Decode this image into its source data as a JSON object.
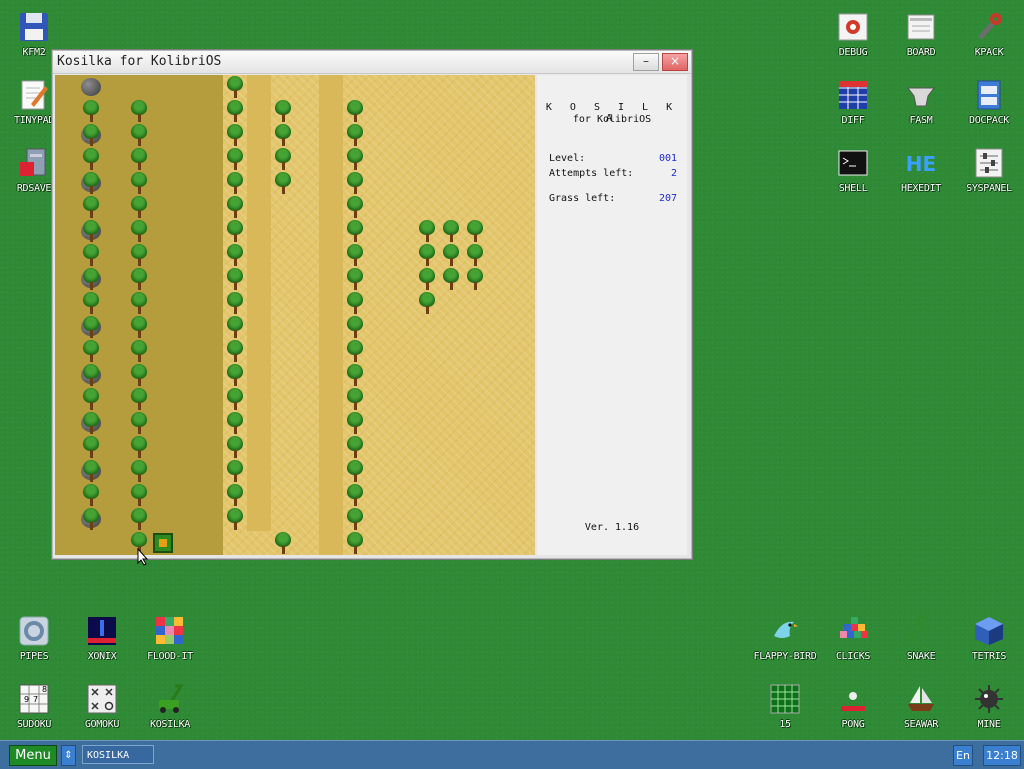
{
  "desktop": {
    "icons": [
      {
        "label": "KFM2",
        "icon": "floppy-disk-icon"
      },
      {
        "label": "TINYPAD",
        "icon": "notepad-pencil-icon"
      },
      {
        "label": "RDSAVE",
        "icon": "ramdisk-save-icon"
      },
      {
        "label": "DEBUG",
        "icon": "debug-bug-icon"
      },
      {
        "label": "BOARD",
        "icon": "clipboard-board-icon"
      },
      {
        "label": "KPACK",
        "icon": "wrench-icon"
      },
      {
        "label": "DIFF",
        "icon": "diff-table-icon"
      },
      {
        "label": "FASM",
        "icon": "anvil-icon"
      },
      {
        "label": "DOCPACK",
        "icon": "cabinet-icon"
      },
      {
        "label": "SHELL",
        "icon": "terminal-icon"
      },
      {
        "label": "HEXEDIT",
        "icon": "hexedit-he-icon"
      },
      {
        "label": "SYSPANEL",
        "icon": "sliders-panel-icon"
      },
      {
        "label": "PIPES",
        "icon": "pipes-game-icon"
      },
      {
        "label": "XONIX",
        "icon": "xonix-game-icon"
      },
      {
        "label": "FLOOD-IT",
        "icon": "flood-it-grid-icon"
      },
      {
        "label": "SUDOKU",
        "icon": "sudoku-grid-icon"
      },
      {
        "label": "GOMOKU",
        "icon": "gomoku-board-icon"
      },
      {
        "label": "KOSILKA",
        "icon": "lawnmower-icon"
      },
      {
        "label": "FLAPPY-BIRD",
        "icon": "bird-icon"
      },
      {
        "label": "CLICKS",
        "icon": "clicks-blocks-icon"
      },
      {
        "label": "SNAKE",
        "icon": "snake-icon"
      },
      {
        "label": "TETRIS",
        "icon": "tetris-cube-icon"
      },
      {
        "label": "15",
        "icon": "fifteen-grid-icon"
      },
      {
        "label": "PONG",
        "icon": "pong-icon"
      },
      {
        "label": "SEAWAR",
        "icon": "sailing-ship-icon"
      },
      {
        "label": "MINE",
        "icon": "mine-icon"
      }
    ]
  },
  "window": {
    "title": "Kosilka for KolibriOS",
    "minimize_label": "–",
    "close_label": "×"
  },
  "game": {
    "heading": "K O S I L K A",
    "subheading": "for KolibriOS",
    "level_label": "Level:",
    "level_value": "001",
    "attempts_label": "Attempts left:",
    "attempts_value": "2",
    "grass_label": "Grass left:",
    "grass_value": "207",
    "version": "Ver. 1.16",
    "grid": {
      "cols": 20,
      "rows": 20,
      "mowed_cols": [
        0,
        1,
        2,
        3,
        4,
        5,
        6
      ],
      "mowed_extra": [
        [
          19,
          7
        ]
      ],
      "tree_cells": [
        [
          0,
          7
        ],
        [
          1,
          1
        ],
        [
          2,
          1
        ],
        [
          3,
          1
        ],
        [
          4,
          1
        ],
        [
          5,
          1
        ],
        [
          6,
          1
        ],
        [
          7,
          1
        ],
        [
          8,
          1
        ],
        [
          9,
          1
        ],
        [
          10,
          1
        ],
        [
          11,
          1
        ],
        [
          12,
          1
        ],
        [
          13,
          1
        ],
        [
          14,
          1
        ],
        [
          15,
          1
        ],
        [
          16,
          1
        ],
        [
          17,
          1
        ],
        [
          18,
          1
        ],
        [
          1,
          3
        ],
        [
          2,
          3
        ],
        [
          3,
          3
        ],
        [
          4,
          3
        ],
        [
          5,
          3
        ],
        [
          6,
          3
        ],
        [
          7,
          3
        ],
        [
          8,
          3
        ],
        [
          9,
          3
        ],
        [
          10,
          3
        ],
        [
          11,
          3
        ],
        [
          12,
          3
        ],
        [
          13,
          3
        ],
        [
          14,
          3
        ],
        [
          15,
          3
        ],
        [
          16,
          3
        ],
        [
          17,
          3
        ],
        [
          18,
          3
        ],
        [
          19,
          3
        ],
        [
          0,
          7
        ],
        [
          1,
          7
        ],
        [
          2,
          7
        ],
        [
          3,
          7
        ],
        [
          4,
          7
        ],
        [
          5,
          7
        ],
        [
          6,
          7
        ],
        [
          7,
          7
        ],
        [
          8,
          7
        ],
        [
          9,
          7
        ],
        [
          10,
          7
        ],
        [
          11,
          7
        ],
        [
          12,
          7
        ],
        [
          13,
          7
        ],
        [
          14,
          7
        ],
        [
          15,
          7
        ],
        [
          16,
          7
        ],
        [
          17,
          7
        ],
        [
          18,
          7
        ],
        [
          1,
          9
        ],
        [
          2,
          9
        ],
        [
          3,
          9
        ],
        [
          4,
          9
        ],
        [
          19,
          9
        ],
        [
          1,
          12
        ],
        [
          2,
          12
        ],
        [
          3,
          12
        ],
        [
          4,
          12
        ],
        [
          5,
          12
        ],
        [
          6,
          12
        ],
        [
          7,
          12
        ],
        [
          8,
          12
        ],
        [
          9,
          12
        ],
        [
          10,
          12
        ],
        [
          11,
          12
        ],
        [
          12,
          12
        ],
        [
          13,
          12
        ],
        [
          14,
          12
        ],
        [
          15,
          12
        ],
        [
          16,
          12
        ],
        [
          17,
          12
        ],
        [
          18,
          12
        ],
        [
          19,
          12
        ],
        [
          6,
          15
        ],
        [
          7,
          15
        ],
        [
          8,
          15
        ],
        [
          9,
          15
        ],
        [
          6,
          16
        ],
        [
          7,
          16
        ],
        [
          8,
          16
        ],
        [
          6,
          17
        ],
        [
          7,
          17
        ],
        [
          8,
          17
        ]
      ],
      "stone_cells": [
        [
          0,
          1
        ],
        [
          2,
          1
        ],
        [
          4,
          1
        ],
        [
          6,
          1
        ],
        [
          8,
          1
        ],
        [
          10,
          1
        ],
        [
          12,
          1
        ],
        [
          14,
          1
        ],
        [
          16,
          1
        ],
        [
          18,
          1
        ]
      ],
      "mower_cell": [
        19,
        4
      ]
    }
  },
  "taskbar": {
    "menu_label": "Menu",
    "scroll_label": "⇕",
    "task_label": "KOSILKA",
    "lang_label": "En",
    "clock": "12:18"
  }
}
